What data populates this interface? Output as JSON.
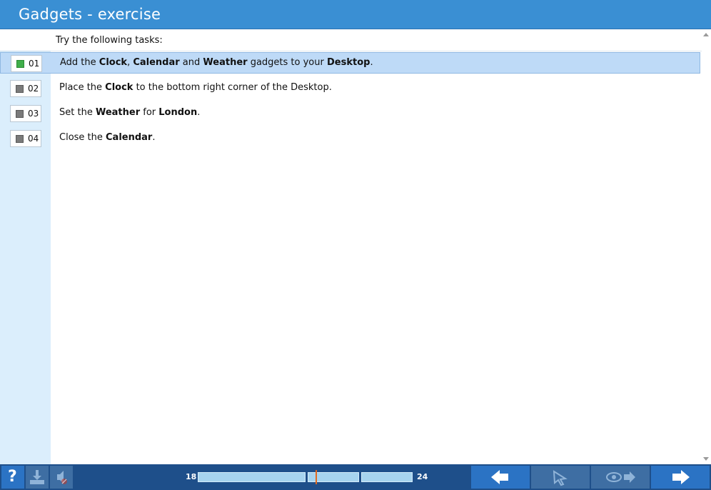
{
  "window": {
    "title": "Gadgets - exercise"
  },
  "intro": "Try the following tasks:",
  "tasks": [
    {
      "number": "01",
      "status": "done",
      "selected": true,
      "parts": [
        "Add the ",
        "Clock",
        ", ",
        "Calendar",
        " and ",
        "Weather",
        " gadgets to your ",
        "Desktop",
        "."
      ]
    },
    {
      "number": "02",
      "status": "pending",
      "selected": false,
      "parts": [
        "Place the ",
        "Clock",
        " to the bottom right corner of the Desktop."
      ]
    },
    {
      "number": "03",
      "status": "pending",
      "selected": false,
      "parts": [
        "Set the ",
        "Weather",
        " for ",
        "London",
        "."
      ]
    },
    {
      "number": "04",
      "status": "pending",
      "selected": false,
      "parts": [
        "Close the ",
        "Calendar",
        "."
      ]
    }
  ],
  "progress": {
    "start_label": "18",
    "end_label": "24",
    "current_fraction": 0.45
  },
  "toolbar": {
    "help_label": "?",
    "icons": [
      "help-icon",
      "download-icon",
      "mute-icon",
      "back-arrow-icon",
      "pointer-icon",
      "view-next-icon",
      "forward-arrow-icon"
    ]
  },
  "colors": {
    "titlebar": "#3a8fd3",
    "selected_row": "#bedaf7",
    "done_status": "#3fae4a",
    "pending_status": "#7a7a7a",
    "bottombar": "#1e4f8a",
    "progress_marker": "#e46a1e"
  }
}
